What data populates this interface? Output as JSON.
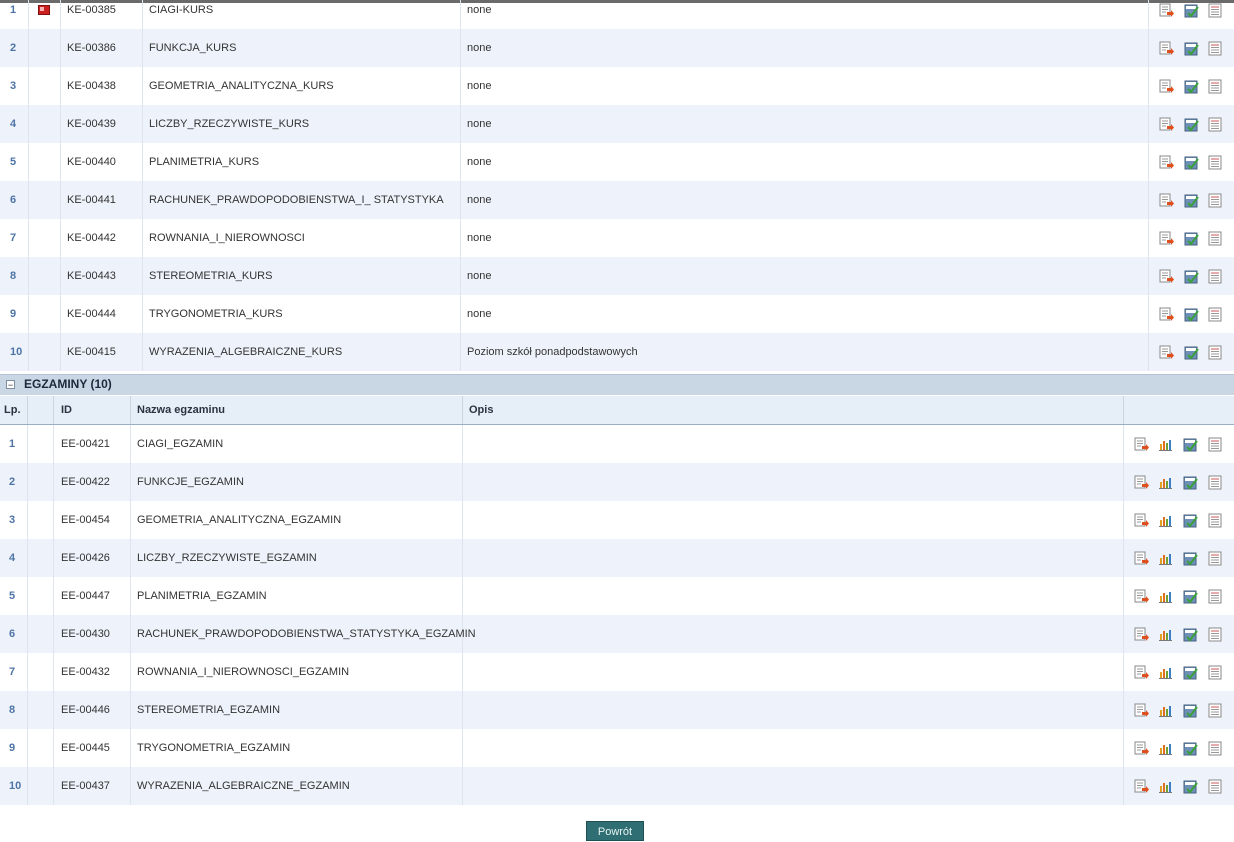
{
  "courses": [
    {
      "lp": "1",
      "id": "KE-00385",
      "name": "CIAGI-KURS",
      "desc": "none"
    },
    {
      "lp": "2",
      "id": "KE-00386",
      "name": "FUNKCJA_KURS",
      "desc": "none"
    },
    {
      "lp": "3",
      "id": "KE-00438",
      "name": "GEOMETRIA_ANALITYCZNA_KURS",
      "desc": "none"
    },
    {
      "lp": "4",
      "id": "KE-00439",
      "name": "LICZBY_RZECZYWISTE_KURS",
      "desc": "none"
    },
    {
      "lp": "5",
      "id": "KE-00440",
      "name": "PLANIMETRIA_KURS",
      "desc": "none"
    },
    {
      "lp": "6",
      "id": "KE-00441",
      "name": "RACHUNEK_PRAWDOPODOBIENSTWA_I_ STATYSTYKA",
      "desc": "none"
    },
    {
      "lp": "7",
      "id": "KE-00442",
      "name": "ROWNANIA_I_NIEROWNOSCI",
      "desc": "none"
    },
    {
      "lp": "8",
      "id": "KE-00443",
      "name": "STEREOMETRIA_KURS",
      "desc": "none"
    },
    {
      "lp": "9",
      "id": "KE-00444",
      "name": "TRYGONOMETRIA_KURS",
      "desc": "none"
    },
    {
      "lp": "10",
      "id": "KE-00415",
      "name": "WYRAZENIA_ALGEBRAICZNE_KURS",
      "desc": "Poziom szkół ponadpodstawowych"
    }
  ],
  "exams_section": {
    "title": "EGZAMINY (10)"
  },
  "exam_headers": {
    "lp": "Lp.",
    "id": "ID",
    "name": "Nazwa egzaminu",
    "desc": "Opis"
  },
  "exams": [
    {
      "lp": "1",
      "id": "EE-00421",
      "name": "CIAGI_EGZAMIN",
      "desc": ""
    },
    {
      "lp": "2",
      "id": "EE-00422",
      "name": "FUNKCJE_EGZAMIN",
      "desc": ""
    },
    {
      "lp": "3",
      "id": "EE-00454",
      "name": "GEOMETRIA_ANALITYCZNA_EGZAMIN",
      "desc": ""
    },
    {
      "lp": "4",
      "id": "EE-00426",
      "name": "LICZBY_RZECZYWISTE_EGZAMIN",
      "desc": ""
    },
    {
      "lp": "5",
      "id": "EE-00447",
      "name": "PLANIMETRIA_EGZAMIN",
      "desc": ""
    },
    {
      "lp": "6",
      "id": "EE-00430",
      "name": "RACHUNEK_PRAWDOPODOBIENSTWA_STATYSTYKA_EGZAMIN",
      "desc": ""
    },
    {
      "lp": "7",
      "id": "EE-00432",
      "name": "ROWNANIA_I_NIEROWNOSCI_EGZAMIN",
      "desc": ""
    },
    {
      "lp": "8",
      "id": "EE-00446",
      "name": "STEREOMETRIA_EGZAMIN",
      "desc": ""
    },
    {
      "lp": "9",
      "id": "EE-00445",
      "name": "TRYGONOMETRIA_EGZAMIN",
      "desc": ""
    },
    {
      "lp": "10",
      "id": "EE-00437",
      "name": "WYRAZENIA_ALGEBRAICZNE_EGZAMIN",
      "desc": ""
    }
  ],
  "course_actions": [
    "export-icon",
    "edit-icon",
    "list-icon"
  ],
  "exam_actions": [
    "export-icon",
    "stats-icon",
    "edit-icon",
    "list-icon"
  ],
  "back_button": {
    "label": "Powrót"
  },
  "colors": {
    "row_alt": "#eef3fb",
    "number": "#4e74a5",
    "section": "#c9d7e5",
    "button": "#2f6f73"
  }
}
